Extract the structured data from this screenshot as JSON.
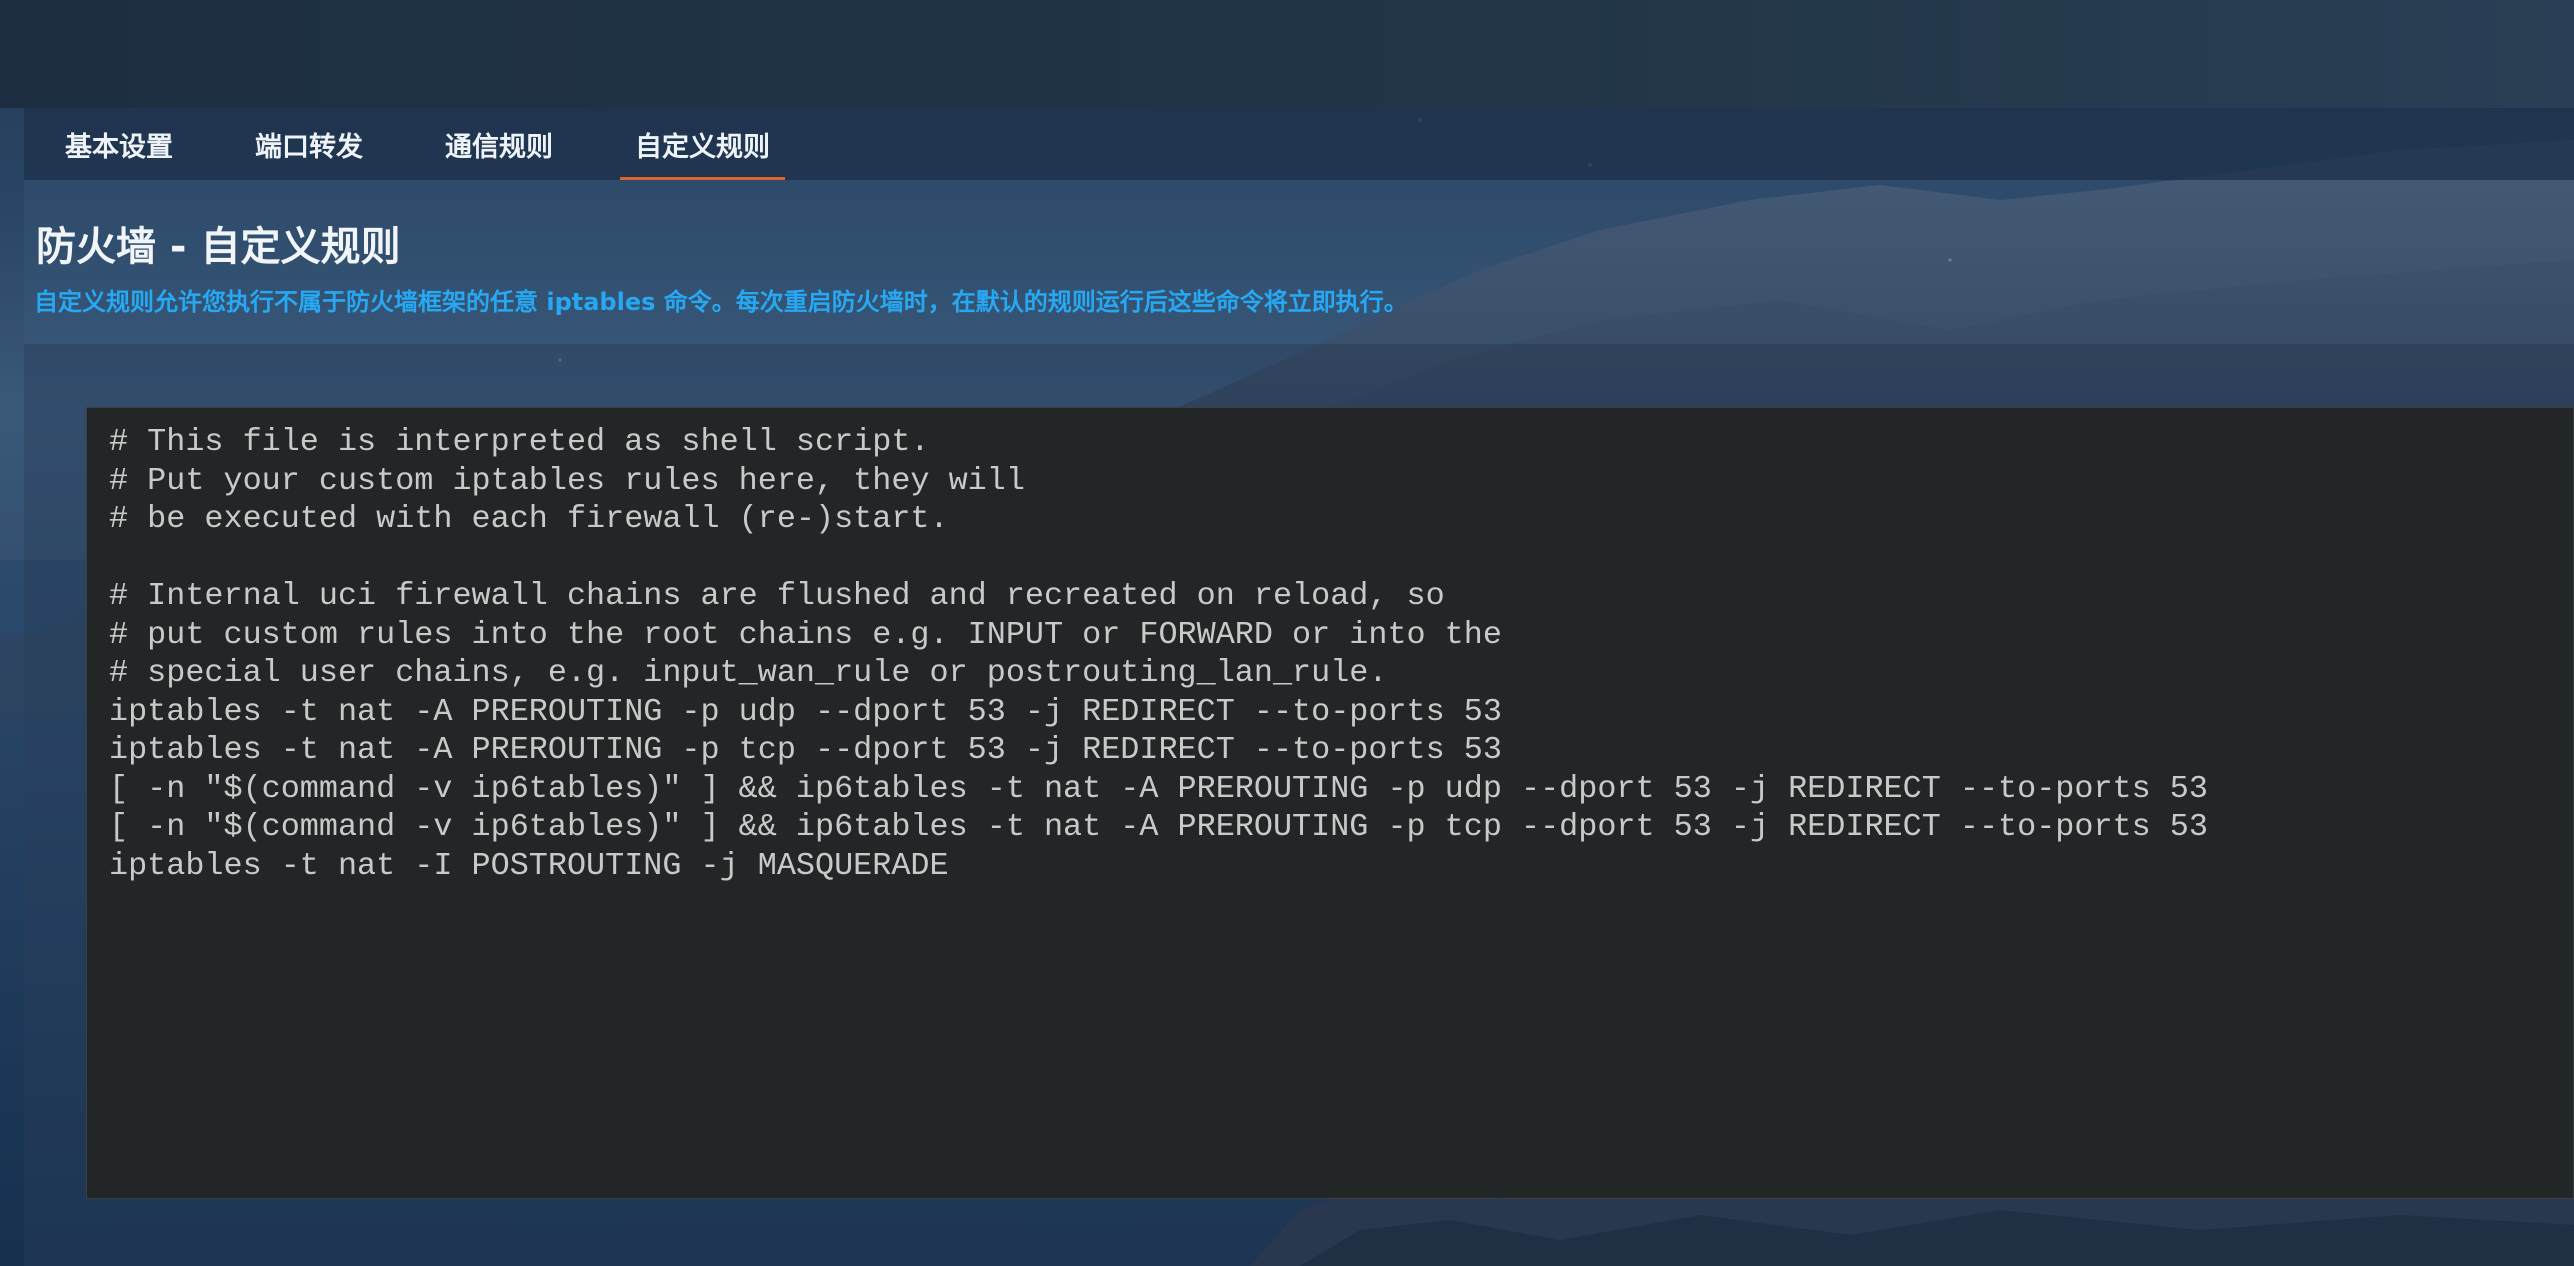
{
  "tabs": [
    {
      "label": "基本设置",
      "active": false
    },
    {
      "label": "端口转发",
      "active": false
    },
    {
      "label": "通信规则",
      "active": false
    },
    {
      "label": "自定义规则",
      "active": true
    }
  ],
  "page": {
    "title": "防火墙 - 自定义规则",
    "description": "自定义规则允许您执行不属于防火墙框架的任意 iptables 命令。每次重启防火墙时，在默认的规则运行后这些命令将立即执行。"
  },
  "editor": {
    "lines": [
      "# This file is interpreted as shell script.",
      "# Put your custom iptables rules here, they will",
      "# be executed with each firewall (re-)start.",
      "",
      "# Internal uci firewall chains are flushed and recreated on reload, so",
      "# put custom rules into the root chains e.g. INPUT or FORWARD or into the",
      "# special user chains, e.g. input_wan_rule or postrouting_lan_rule.",
      "iptables -t nat -A PREROUTING -p udp --dport 53 -j REDIRECT --to-ports 53",
      "iptables -t nat -A PREROUTING -p tcp --dport 53 -j REDIRECT --to-ports 53",
      "[ -n \"$(command -v ip6tables)\" ] && ip6tables -t nat -A PREROUTING -p udp --dport 53 -j REDIRECT --to-ports 53",
      "[ -n \"$(command -v ip6tables)\" ] && ip6tables -t nat -A PREROUTING -p tcp --dport 53 -j REDIRECT --to-ports 53",
      "iptables -t nat -I POSTROUTING -j MASQUERADE"
    ]
  },
  "colors": {
    "accent": "#e0622e",
    "description": "#27a8f2",
    "editor_bg": "#232627",
    "editor_text": "#c9c9c9"
  }
}
